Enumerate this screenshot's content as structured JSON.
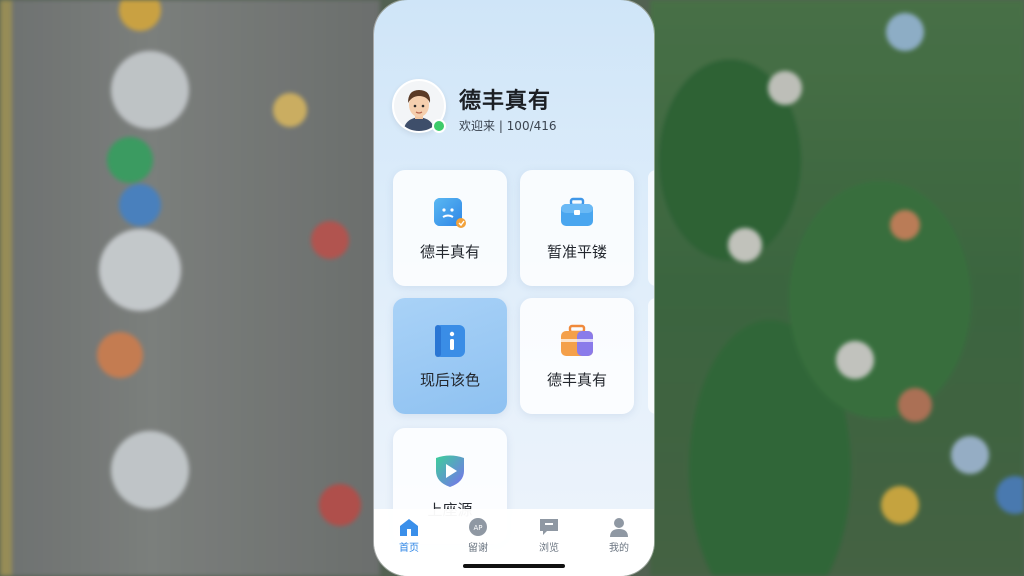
{
  "profile": {
    "name": "德丰真有",
    "subtitle": "欢迎来 | 100/416",
    "status": "online"
  },
  "grid": [
    {
      "label": "德丰真有",
      "icon": "chat-card-icon",
      "active": false
    },
    {
      "label": "暂准平镂",
      "icon": "briefcase-icon",
      "active": false
    },
    {
      "label": "现后该色",
      "icon": "info-book-icon",
      "active": true
    },
    {
      "label": "德丰真有",
      "icon": "toolbox-icon",
      "active": false
    },
    {
      "label": "上座源",
      "icon": "shield-play-icon",
      "active": false
    }
  ],
  "tabs": [
    {
      "label": "首页",
      "icon": "home-icon",
      "active": true
    },
    {
      "label": "留谢",
      "icon": "discover-icon",
      "active": false
    },
    {
      "label": "浏览",
      "icon": "message-icon",
      "active": false
    },
    {
      "label": "我的",
      "icon": "person-icon",
      "active": false
    }
  ],
  "colors": {
    "accent": "#2f86e6",
    "online": "#3ecb6a"
  }
}
